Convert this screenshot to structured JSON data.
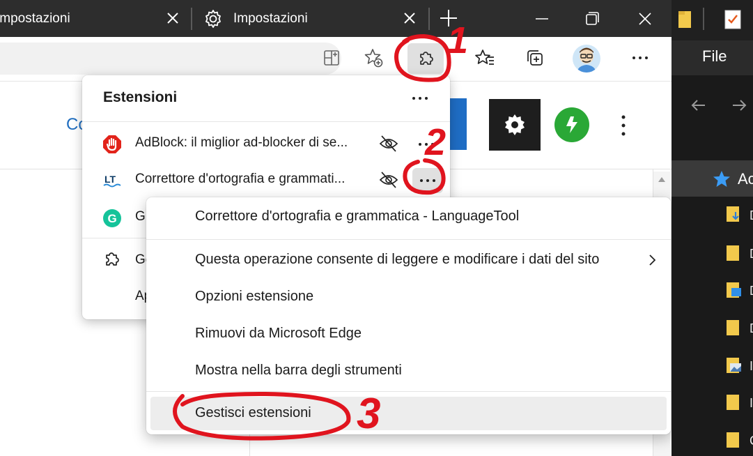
{
  "tabs": [
    {
      "title": "Impostazioni",
      "icon": "gear-icon"
    },
    {
      "title": "Impostazioni",
      "icon": "gear-icon"
    }
  ],
  "toolbar": {
    "icons": [
      "split-screen-icon",
      "add-favorite-icon",
      "extensions-icon",
      "favorites-icon",
      "collections-icon",
      "profile-avatar",
      "more-icon"
    ]
  },
  "page": {
    "link_partial": "Co"
  },
  "extensions_flyout": {
    "title": "Estensioni",
    "items": [
      {
        "name": "AdBlock: il miglior ad-blocker di se...",
        "icon": "adblock-icon"
      },
      {
        "name": "Correttore d'ortografia e grammati...",
        "icon": "languagetool-icon"
      },
      {
        "name": "Gr",
        "icon": "grammarly-icon"
      }
    ],
    "manage_partial": "Ge",
    "open_partial": "Ap"
  },
  "context_menu": {
    "header": "Correttore d'ortografia e grammatica - LanguageTool",
    "items": [
      {
        "label": "Questa operazione consente di leggere e modificare i dati del sito",
        "submenu": true
      },
      {
        "label": "Opzioni estensione"
      },
      {
        "label": "Rimuovi da Microsoft Edge"
      },
      {
        "label": "Mostra nella barra degli strumenti"
      },
      {
        "label": "Gestisci estensioni",
        "highlighted": true
      }
    ]
  },
  "explorer": {
    "menu_file": "File",
    "quick_access_partial": "Ac",
    "row_letters": [
      "D",
      "D",
      "D",
      "D",
      "I",
      "I",
      "C"
    ]
  },
  "annotations": [
    "1",
    "2",
    "3"
  ],
  "colors": {
    "tabstrip": "#2d2d2d",
    "annotation_red": "#e0141e",
    "menu_hover": "#ededed",
    "link_blue": "#1f6dbf",
    "green_icon": "#2aa836"
  }
}
